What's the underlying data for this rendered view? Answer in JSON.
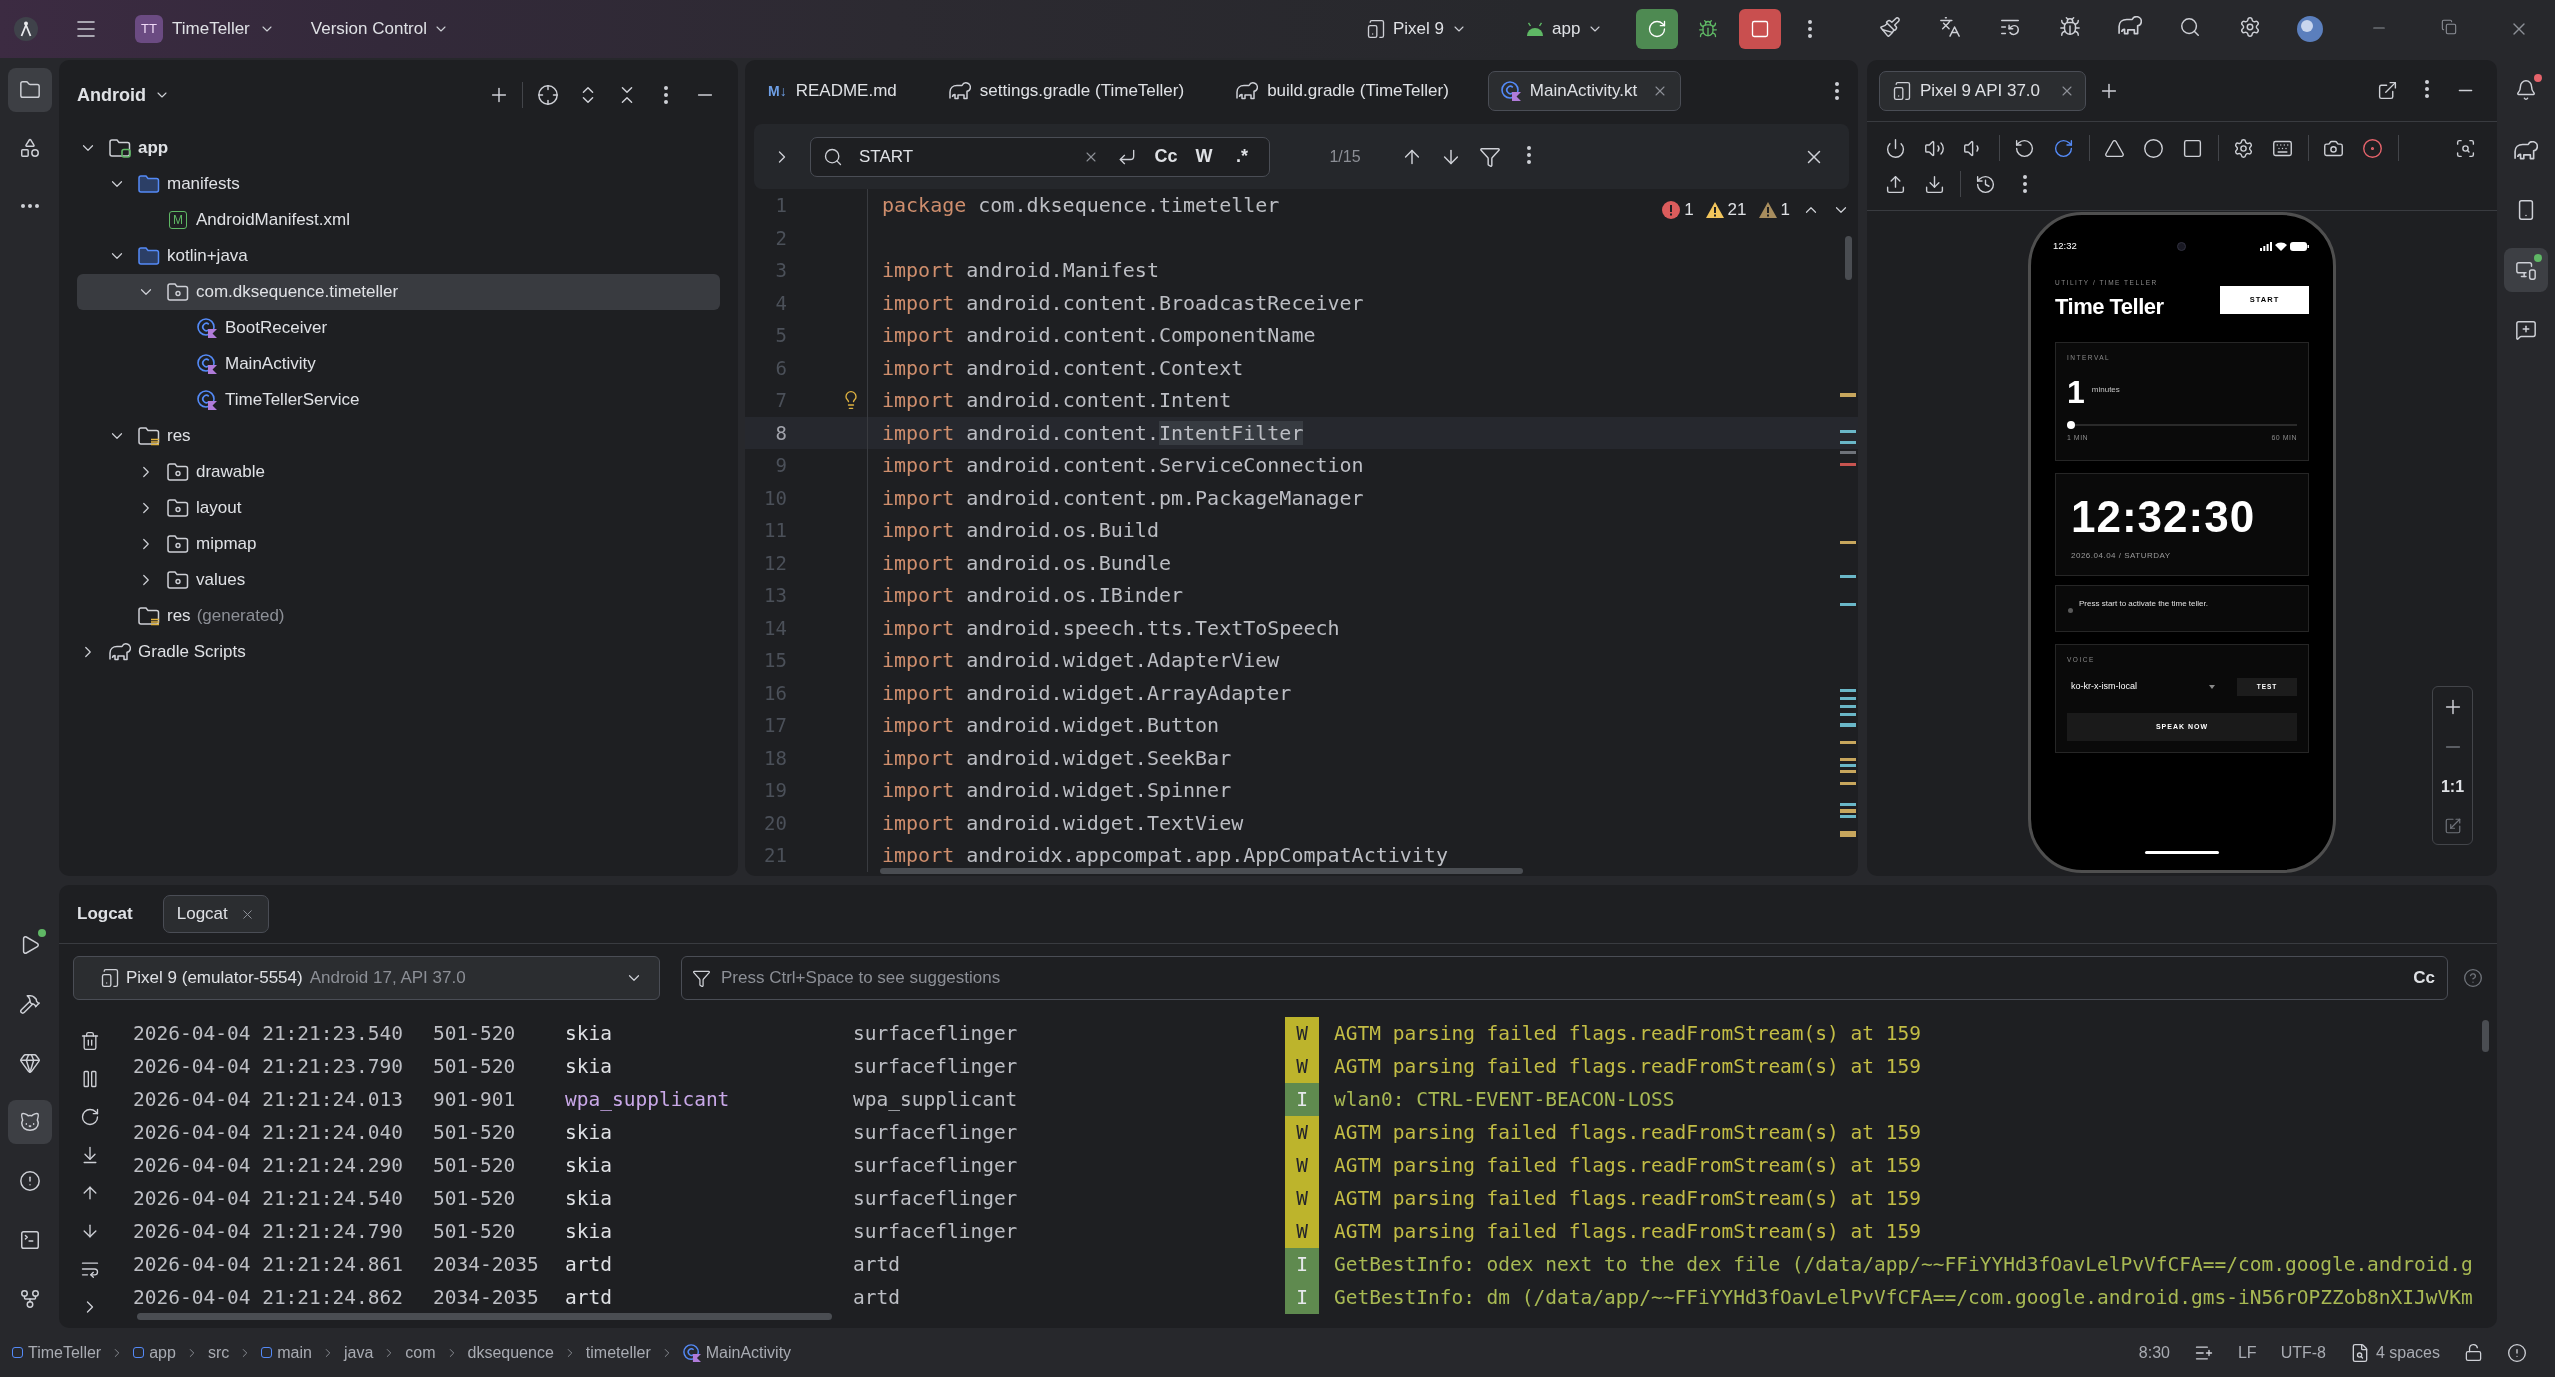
{
  "title_bar": {
    "project": {
      "initials": "TT",
      "name": "TimeTeller"
    },
    "vcs": "Version Control",
    "device": "Pixel 9",
    "run_config": "app"
  },
  "left_toolbar": {
    "top": [
      {
        "kind": "project",
        "selected": true
      },
      {
        "kind": "resource_manager",
        "selected": false
      },
      {
        "kind": "more",
        "selected": false
      }
    ],
    "bottom": [
      {
        "kind": "run",
        "selected": false,
        "color": "#5fb865"
      },
      {
        "kind": "build",
        "selected": false
      },
      {
        "kind": "quality_insights",
        "selected": false
      },
      {
        "kind": "logcat",
        "selected": true
      },
      {
        "kind": "problems",
        "selected": false
      },
      {
        "kind": "terminal",
        "selected": false
      },
      {
        "kind": "git",
        "selected": false
      }
    ]
  },
  "project_panel": {
    "view": "Android",
    "tree": [
      {
        "label": "app",
        "kind": "module",
        "expanded": true,
        "selected": false,
        "children": [
          {
            "label": "manifests",
            "kind": "folder",
            "expanded": true,
            "selected": false,
            "children": [
              {
                "label": "AndroidManifest.xml",
                "kind": "manifest",
                "badge": "M",
                "selected": false
              }
            ]
          },
          {
            "label": "kotlin+java",
            "kind": "folder",
            "expanded": true,
            "selected": false,
            "children": [
              {
                "label": "com.dksequence.timeteller",
                "kind": "package",
                "expanded": true,
                "selected": true,
                "children": [
                  {
                    "label": "BootReceiver",
                    "kind": "class",
                    "selected": false
                  },
                  {
                    "label": "MainActivity",
                    "kind": "class",
                    "selected": false
                  },
                  {
                    "label": "TimeTellerService",
                    "kind": "class",
                    "selected": false
                  }
                ]
              }
            ]
          },
          {
            "label": "res",
            "kind": "res",
            "expanded": true,
            "selected": false,
            "children": [
              {
                "label": "drawable",
                "kind": "directory",
                "expanded": false,
                "selected": false
              },
              {
                "label": "layout",
                "kind": "directory",
                "expanded": false,
                "selected": false
              },
              {
                "label": "mipmap",
                "kind": "directory",
                "expanded": false,
                "selected": false
              },
              {
                "label": "values",
                "kind": "directory",
                "expanded": false,
                "selected": false
              }
            ]
          },
          {
            "label": "res",
            "suffix": "(generated)",
            "kind": "res",
            "selected": false
          }
        ]
      },
      {
        "label": "Gradle Scripts",
        "kind": "gradle",
        "expanded": false,
        "selected": false
      }
    ]
  },
  "editor": {
    "tabs": [
      {
        "label": "README.md",
        "kind": "markdown",
        "icon_text": "M↓",
        "selected": false
      },
      {
        "label": "settings.gradle (TimeTeller)",
        "kind": "gradle",
        "selected": false
      },
      {
        "label": "build.gradle (TimeTeller)",
        "kind": "gradle",
        "selected": false
      },
      {
        "label": "MainActivity.kt",
        "kind": "kotlin",
        "selected": true
      }
    ],
    "find": {
      "query": "START",
      "options": [
        {
          "label": "Cc",
          "selected": false
        },
        {
          "label": "W",
          "selected": false
        },
        {
          "label": ".*",
          "selected": false
        }
      ],
      "match_count": "1/15"
    },
    "inspections": {
      "errors": "1",
      "warnings": "21",
      "weak_warnings": "1"
    },
    "lines": [
      {
        "number": "1",
        "tokens": [
          {
            "kind": "keyword",
            "text": "package "
          },
          {
            "kind": "plain",
            "text": "com.dksequence.timeteller"
          }
        ],
        "current": false,
        "bulb": false
      },
      {
        "number": "2",
        "current": false,
        "bulb": false
      },
      {
        "number": "3",
        "tokens": [
          {
            "kind": "keyword",
            "text": "import "
          },
          {
            "kind": "plain",
            "text": "android.Manifest"
          }
        ],
        "current": false,
        "bulb": false
      },
      {
        "number": "4",
        "tokens": [
          {
            "kind": "keyword",
            "text": "import "
          },
          {
            "kind": "plain",
            "text": "android.content.BroadcastReceiver"
          }
        ],
        "current": false,
        "bulb": false
      },
      {
        "number": "5",
        "tokens": [
          {
            "kind": "keyword",
            "text": "import "
          },
          {
            "kind": "plain",
            "text": "android.content.ComponentName"
          }
        ],
        "current": false,
        "bulb": false
      },
      {
        "number": "6",
        "tokens": [
          {
            "kind": "keyword",
            "text": "import "
          },
          {
            "kind": "plain",
            "text": "android.content.Context"
          }
        ],
        "current": false,
        "bulb": false
      },
      {
        "number": "7",
        "tokens": [
          {
            "kind": "keyword",
            "text": "import "
          },
          {
            "kind": "plain",
            "text": "android.content.Intent"
          }
        ],
        "current": false,
        "bulb": true
      },
      {
        "number": "8",
        "tokens": [
          {
            "kind": "keyword",
            "text": "import "
          },
          {
            "kind": "plain",
            "text": "android.content."
          },
          {
            "kind": "highlight",
            "text": "IntentFilter"
          }
        ],
        "current": true,
        "bulb": false
      },
      {
        "number": "9",
        "tokens": [
          {
            "kind": "keyword",
            "text": "import "
          },
          {
            "kind": "plain",
            "text": "android.content.ServiceConnection"
          }
        ],
        "current": false,
        "bulb": false
      },
      {
        "number": "10",
        "tokens": [
          {
            "kind": "keyword",
            "text": "import "
          },
          {
            "kind": "plain",
            "text": "android.content.pm.PackageManager"
          }
        ],
        "current": false,
        "bulb": false
      },
      {
        "number": "11",
        "tokens": [
          {
            "kind": "keyword",
            "text": "import "
          },
          {
            "kind": "plain",
            "text": "android.os.Build"
          }
        ],
        "current": false,
        "bulb": false
      },
      {
        "number": "12",
        "tokens": [
          {
            "kind": "keyword",
            "text": "import "
          },
          {
            "kind": "plain",
            "text": "android.os.Bundle"
          }
        ],
        "current": false,
        "bulb": false
      },
      {
        "number": "13",
        "tokens": [
          {
            "kind": "keyword",
            "text": "import "
          },
          {
            "kind": "plain",
            "text": "android.os.IBinder"
          }
        ],
        "current": false,
        "bulb": false
      },
      {
        "number": "14",
        "tokens": [
          {
            "kind": "keyword",
            "text": "import "
          },
          {
            "kind": "plain",
            "text": "android.speech.tts.TextToSpeech"
          }
        ],
        "current": false,
        "bulb": false
      },
      {
        "number": "15",
        "tokens": [
          {
            "kind": "keyword",
            "text": "import "
          },
          {
            "kind": "plain",
            "text": "android.widget.AdapterView"
          }
        ],
        "current": false,
        "bulb": false
      },
      {
        "number": "16",
        "tokens": [
          {
            "kind": "keyword",
            "text": "import "
          },
          {
            "kind": "plain",
            "text": "android.widget.ArrayAdapter"
          }
        ],
        "current": false,
        "bulb": false
      },
      {
        "number": "17",
        "tokens": [
          {
            "kind": "keyword",
            "text": "import "
          },
          {
            "kind": "plain",
            "text": "android.widget.Button"
          }
        ],
        "current": false,
        "bulb": false
      },
      {
        "number": "18",
        "tokens": [
          {
            "kind": "keyword",
            "text": "import "
          },
          {
            "kind": "plain",
            "text": "android.widget.SeekBar"
          }
        ],
        "current": false,
        "bulb": false
      },
      {
        "number": "19",
        "tokens": [
          {
            "kind": "keyword",
            "text": "import "
          },
          {
            "kind": "plain",
            "text": "android.widget.Spinner"
          }
        ],
        "current": false,
        "bulb": false
      },
      {
        "number": "20",
        "tokens": [
          {
            "kind": "keyword",
            "text": "import "
          },
          {
            "kind": "plain",
            "text": "android.widget.TextView"
          }
        ],
        "current": false,
        "bulb": false
      },
      {
        "number": "21",
        "tokens": [
          {
            "kind": "keyword",
            "text": "import "
          },
          {
            "kind": "plain",
            "text": "androidx.appcompat.app.AppCompatActivity"
          }
        ],
        "current": false,
        "bulb": false
      }
    ]
  },
  "emulator": {
    "tabs": [
      {
        "label": "Pixel 9 API 37.0",
        "selected": true
      }
    ],
    "screen": {
      "status_time": "12:32",
      "overline": "UTILITY / TIME TELLER",
      "title": "Time Teller",
      "start_button": "START",
      "interval": {
        "label": "INTERVAL",
        "value": "1",
        "unit": "minutes",
        "level": 0,
        "min_label": "1 MIN",
        "max_label": "60 MIN"
      },
      "clock": {
        "time": "12:32:30",
        "date": "2026.04.04 / SATURDAY"
      },
      "status_message": "Press start to activate the time teller.",
      "voice": {
        "label": "VOICE",
        "value": "ko-kr-x-ism-local",
        "test_button": "TEST",
        "speak_button": "SPEAK NOW"
      }
    },
    "zoom": {
      "actual_size": "1:1"
    }
  },
  "right_toolbar": [
    {
      "kind": "notifications",
      "selected": false,
      "color": "#e5636b"
    },
    {
      "kind": "gradle",
      "selected": false
    },
    {
      "kind": "device_manager",
      "selected": false
    },
    {
      "kind": "running_devices",
      "selected": true,
      "color": "#5fb865"
    },
    {
      "kind": "assistant",
      "selected": false
    }
  ],
  "logcat": {
    "title": "Logcat",
    "tabs": [
      {
        "label": "Logcat",
        "selected": true
      }
    ],
    "device": {
      "name": "Pixel 9 (emulator-5554)",
      "details": "Android 17, API 37.0"
    },
    "filter": {
      "placeholder": "Press Ctrl+Space to see suggestions",
      "case_button": "Cc"
    },
    "rows": [
      {
        "timestamp": "2026-04-04 21:21:23.540",
        "pid": "501-520",
        "tag": "skia",
        "color": "#dfe1e5",
        "package": "surfaceflinger",
        "kind": "warning",
        "level": "W",
        "message": "AGTM parsing failed flags.readFromStream(s) at 159"
      },
      {
        "timestamp": "2026-04-04 21:21:23.790",
        "pid": "501-520",
        "tag": "skia",
        "color": "#dfe1e5",
        "package": "surfaceflinger",
        "kind": "warning",
        "level": "W",
        "message": "AGTM parsing failed flags.readFromStream(s) at 159"
      },
      {
        "timestamp": "2026-04-04 21:21:24.013",
        "pid": "901-901",
        "tag": "wpa_supplicant",
        "color": "#c9a8e8",
        "package": "wpa_supplicant",
        "kind": "info",
        "level": "I",
        "message": "wlan0: CTRL-EVENT-BEACON-LOSS"
      },
      {
        "timestamp": "2026-04-04 21:21:24.040",
        "pid": "501-520",
        "tag": "skia",
        "color": "#dfe1e5",
        "package": "surfaceflinger",
        "kind": "warning",
        "level": "W",
        "message": "AGTM parsing failed flags.readFromStream(s) at 159"
      },
      {
        "timestamp": "2026-04-04 21:21:24.290",
        "pid": "501-520",
        "tag": "skia",
        "color": "#dfe1e5",
        "package": "surfaceflinger",
        "kind": "warning",
        "level": "W",
        "message": "AGTM parsing failed flags.readFromStream(s) at 159"
      },
      {
        "timestamp": "2026-04-04 21:21:24.540",
        "pid": "501-520",
        "tag": "skia",
        "color": "#dfe1e5",
        "package": "surfaceflinger",
        "kind": "warning",
        "level": "W",
        "message": "AGTM parsing failed flags.readFromStream(s) at 159"
      },
      {
        "timestamp": "2026-04-04 21:21:24.790",
        "pid": "501-520",
        "tag": "skia",
        "color": "#dfe1e5",
        "package": "surfaceflinger",
        "kind": "warning",
        "level": "W",
        "message": "AGTM parsing failed flags.readFromStream(s) at 159"
      },
      {
        "timestamp": "2026-04-04 21:21:24.861",
        "pid": "2034-2035",
        "tag": "artd",
        "color": "#dfe1e5",
        "package": "artd",
        "kind": "info",
        "level": "I",
        "message": "GetBestInfo: odex next to the dex file (/data/app/~~FFiYYHd3fOavLelPvVfCFA==/com.google.android.g"
      },
      {
        "timestamp": "2026-04-04 21:21:24.862",
        "pid": "2034-2035",
        "tag": "artd",
        "color": "#dfe1e5",
        "package": "artd",
        "kind": "info",
        "level": "I",
        "message": "GetBestInfo: dm (/data/app/~~FFiYYHd3fOavLelPvVfCFA==/com.google.android.gms-iN56rOPZZob8nXIJwVKm"
      }
    ]
  },
  "status_bar": {
    "breadcrumbs": [
      {
        "label": "TimeTeller",
        "kind": "module"
      },
      {
        "label": "app",
        "kind": "module"
      },
      {
        "label": "src",
        "kind": "folder"
      },
      {
        "label": "main",
        "kind": "module"
      },
      {
        "label": "java",
        "kind": "folder"
      },
      {
        "label": "com",
        "kind": "folder"
      },
      {
        "label": "dksequence",
        "kind": "folder"
      },
      {
        "label": "timeteller",
        "kind": "folder"
      },
      {
        "label": "MainActivity",
        "kind": "class"
      }
    ],
    "caret": "8:30",
    "line_separator": "LF",
    "encoding": "UTF-8",
    "indent": "4 spaces"
  }
}
